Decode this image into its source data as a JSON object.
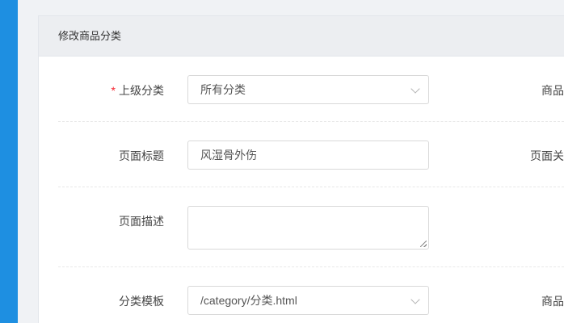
{
  "panel": {
    "title": "修改商品分类"
  },
  "form": {
    "parent_category": {
      "label": "上级分类",
      "required_mark": "*",
      "value": "所有分类"
    },
    "page_title": {
      "label": "页面标题",
      "value": "风湿骨外伤"
    },
    "page_description": {
      "label": "页面描述",
      "value": ""
    },
    "category_template": {
      "label": "分类模板",
      "value": "/category/分类.html"
    }
  },
  "right_column": {
    "row1_label": "商品",
    "row2_label": "页面关",
    "row4_label": "商品"
  },
  "colors": {
    "accent": "#1e8fe1",
    "required": "#f5222d"
  },
  "icons": {
    "select_arrow": "chevron-down-icon",
    "resize": "resize-handle-icon"
  }
}
